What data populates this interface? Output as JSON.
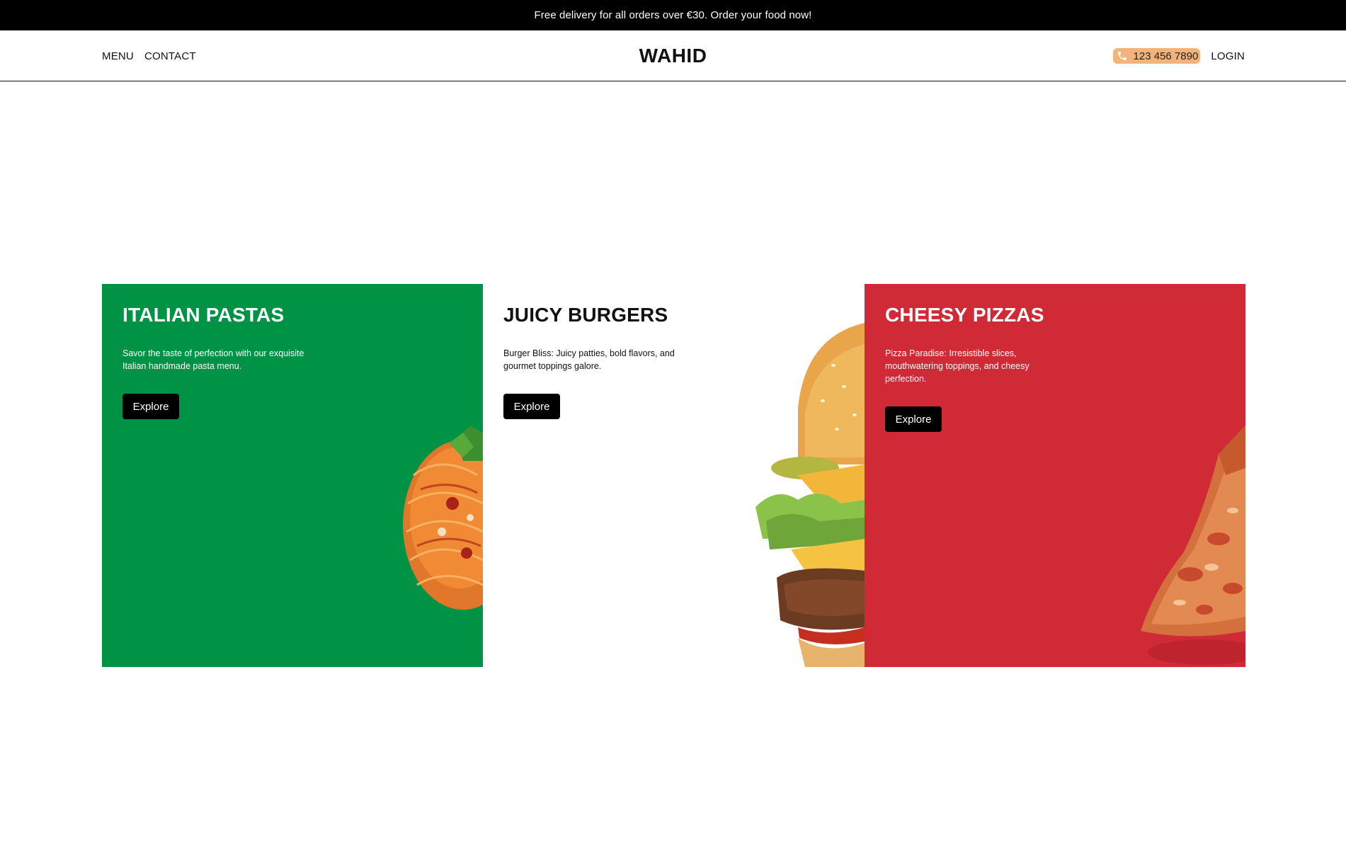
{
  "announcement": "Free delivery for all orders over €30. Order your food now!",
  "header": {
    "nav_left": [
      "MENU",
      "CONTACT"
    ],
    "brand": "WAHID",
    "phone": "123 456 7890",
    "login": "LOGIN"
  },
  "cards": [
    {
      "title": "ITALIAN PASTAS",
      "description": "Savor the taste of perfection with our exquisite Italian handmade pasta menu.",
      "button": "Explore",
      "background": "#009245",
      "image_icon": "pasta-image"
    },
    {
      "title": "JUICY BURGERS",
      "description": "Burger Bliss: Juicy patties, bold flavors, and gourmet toppings galore.",
      "button": "Explore",
      "background": "#ffffff",
      "image_icon": "burger-image"
    },
    {
      "title": "CHEESY PIZZAS",
      "description": "Pizza Paradise: Irresistible slices, mouthwatering toppings, and cheesy perfection.",
      "button": "Explore",
      "background": "#cf2a36",
      "image_icon": "pizza-image"
    }
  ],
  "colors": {
    "accent_phone": "#f2b47a",
    "announcement_bg": "#000000",
    "button_bg": "#000000"
  }
}
